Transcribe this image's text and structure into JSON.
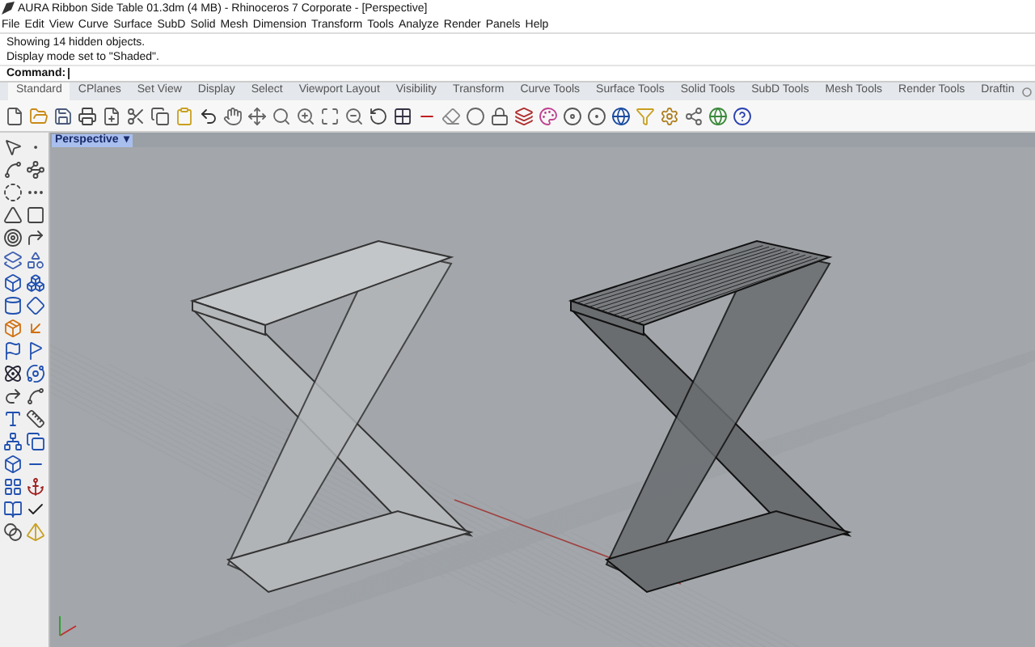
{
  "window": {
    "title": "AURA Ribbon Side Table 01.3dm (4 MB) - Rhinoceros 7 Corporate - [Perspective]"
  },
  "menu": [
    "File",
    "Edit",
    "View",
    "Curve",
    "Surface",
    "SubD",
    "Solid",
    "Mesh",
    "Dimension",
    "Transform",
    "Tools",
    "Analyze",
    "Render",
    "Panels",
    "Help"
  ],
  "command_history": [
    "Showing 14 hidden objects.",
    "Display mode set to \"Shaded\"."
  ],
  "command": {
    "label": "Command:"
  },
  "tabs": [
    {
      "label": "Standard",
      "selected": true
    },
    {
      "label": "CPlanes",
      "selected": false
    },
    {
      "label": "Set View",
      "selected": false
    },
    {
      "label": "Display",
      "selected": false
    },
    {
      "label": "Select",
      "selected": false
    },
    {
      "label": "Viewport Layout",
      "selected": false
    },
    {
      "label": "Visibility",
      "selected": false
    },
    {
      "label": "Transform",
      "selected": false
    },
    {
      "label": "Curve Tools",
      "selected": false
    },
    {
      "label": "Surface Tools",
      "selected": false
    },
    {
      "label": "Solid Tools",
      "selected": false
    },
    {
      "label": "SubD Tools",
      "selected": false
    },
    {
      "label": "Mesh Tools",
      "selected": false
    },
    {
      "label": "Render Tools",
      "selected": false
    },
    {
      "label": "Draftin",
      "selected": false
    }
  ],
  "viewport": {
    "title": "Perspective",
    "caret": "▾"
  }
}
